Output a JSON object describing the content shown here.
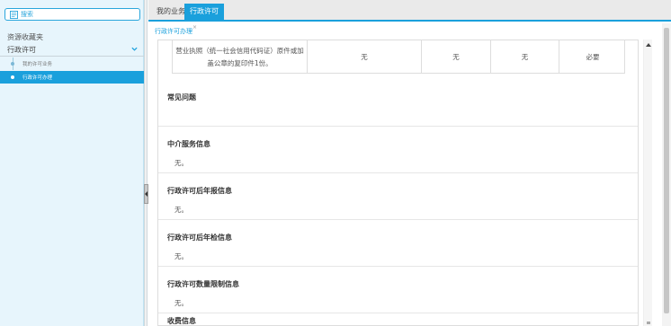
{
  "sidebar": {
    "search_label": "搜索",
    "favorites_heading": "资源收藏夹",
    "section_label": "行政许可",
    "items": [
      {
        "label": "我的许可业务"
      },
      {
        "label": "行政许可办理"
      }
    ]
  },
  "tabs": [
    {
      "label": "我的业务"
    },
    {
      "label": "行政许可"
    }
  ],
  "subtab": {
    "label": "行政许可办理",
    "close": "×"
  },
  "materials_row": {
    "name_line1": "营业执照（统一社会信用代码证）原件或加",
    "name_line2": "盖公章的复印件1份。",
    "col2": "无",
    "col3": "无",
    "col4": "无",
    "col5": "必要"
  },
  "sections": [
    {
      "title": "常见问题",
      "body": ""
    },
    {
      "title": "中介服务信息",
      "body": "无。"
    },
    {
      "title": "行政许可后年报信息",
      "body": "无。"
    },
    {
      "title": "行政许可后年检信息",
      "body": "无。"
    },
    {
      "title": "行政许可数量限制信息",
      "body": "无。"
    },
    {
      "title": "收费信息",
      "body": ""
    }
  ],
  "colors": {
    "accent": "#1aa0dc",
    "sidebar_bg": "#e7f5fc"
  }
}
